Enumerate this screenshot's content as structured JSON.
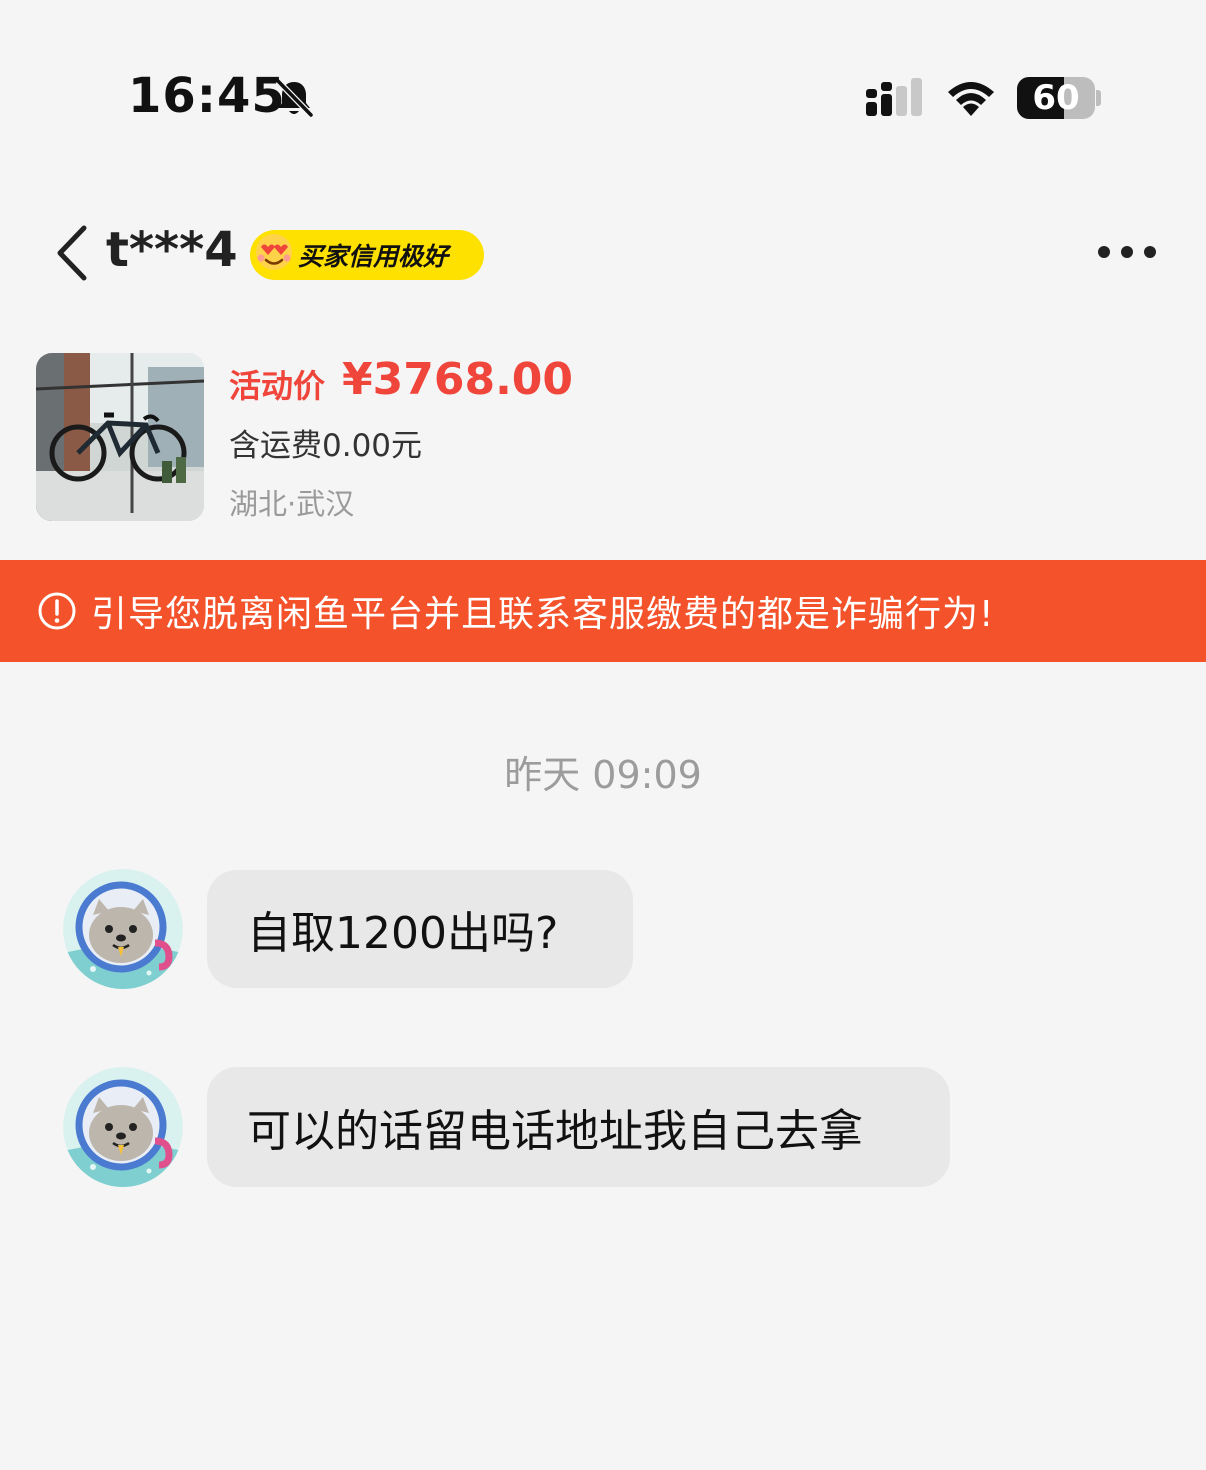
{
  "status_bar": {
    "time": "16:45",
    "battery": "60",
    "battery_level": 0.6,
    "icons": [
      "bell-slash-icon",
      "cellular-signal-icon",
      "wifi-icon",
      "battery-icon"
    ]
  },
  "header": {
    "back_icon": "chevron-left-icon",
    "username": "t***4",
    "badge_text": "买家信用极好",
    "badge_icon": "heart-eyes-emoji-icon",
    "more_icon": "more-dots-icon"
  },
  "product": {
    "image": "bicycle-photo",
    "price_label": "活动价",
    "price": "¥3768.00",
    "shipping": "含运费0.00元",
    "location": "湖北·武汉"
  },
  "warning": {
    "icon": "exclamation-circle-icon",
    "text": "引导您脱离闲鱼平台并且联系客服缴费的都是诈骗行为!"
  },
  "chat": {
    "timestamp": "昨天 09:09",
    "messages": [
      {
        "text": "自取1200出吗?"
      },
      {
        "text": "可以的话留电话地址我自己去拿"
      }
    ]
  },
  "colors": {
    "background": "#f5f5f5",
    "price_red": "#f0453a",
    "warning_orange": "#f4522a",
    "badge_yellow": "#ffe100",
    "bubble_gray": "#e8e8e8"
  }
}
